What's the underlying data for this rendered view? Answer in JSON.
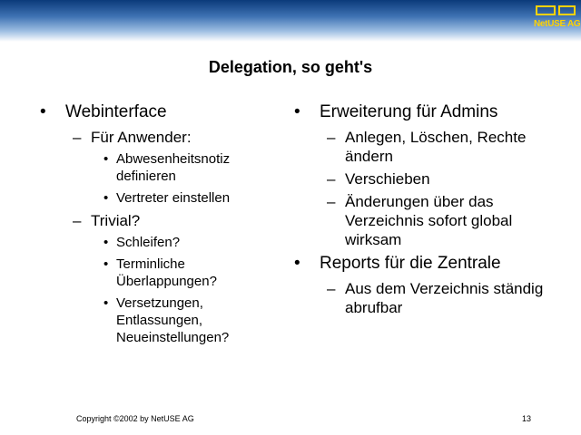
{
  "header": {
    "brand": "NetUSE AG"
  },
  "title": "Delegation, so geht's",
  "left": {
    "item1": "Webinterface",
    "sub1": "Für Anwender:",
    "sub1_items": [
      "Abwesenheitsnotiz definieren",
      "Vertreter einstellen"
    ],
    "sub2": "Trivial?",
    "sub2_items": [
      "Schleifen?",
      "Terminliche Überlappungen?",
      "Versetzungen, Entlassungen, Neueinstellungen?"
    ]
  },
  "right": {
    "item1": "Erweiterung für Admins",
    "item1_subs": [
      "Anlegen, Löschen, Rechte ändern",
      "Verschieben",
      "Änderungen über das Verzeichnis sofort global wirksam"
    ],
    "item2": "Reports für die Zentrale",
    "item2_subs": [
      "Aus dem Verzeichnis ständig abrufbar"
    ]
  },
  "markers": {
    "bullet": "•",
    "dash": "–"
  },
  "footer": {
    "copyright": "Copyright ©2002 by NetUSE AG",
    "page_number": "13"
  },
  "colors": {
    "header_dark": "#0b3a7a",
    "header_light": "#9fbfe3",
    "logo": "#ffd200"
  }
}
